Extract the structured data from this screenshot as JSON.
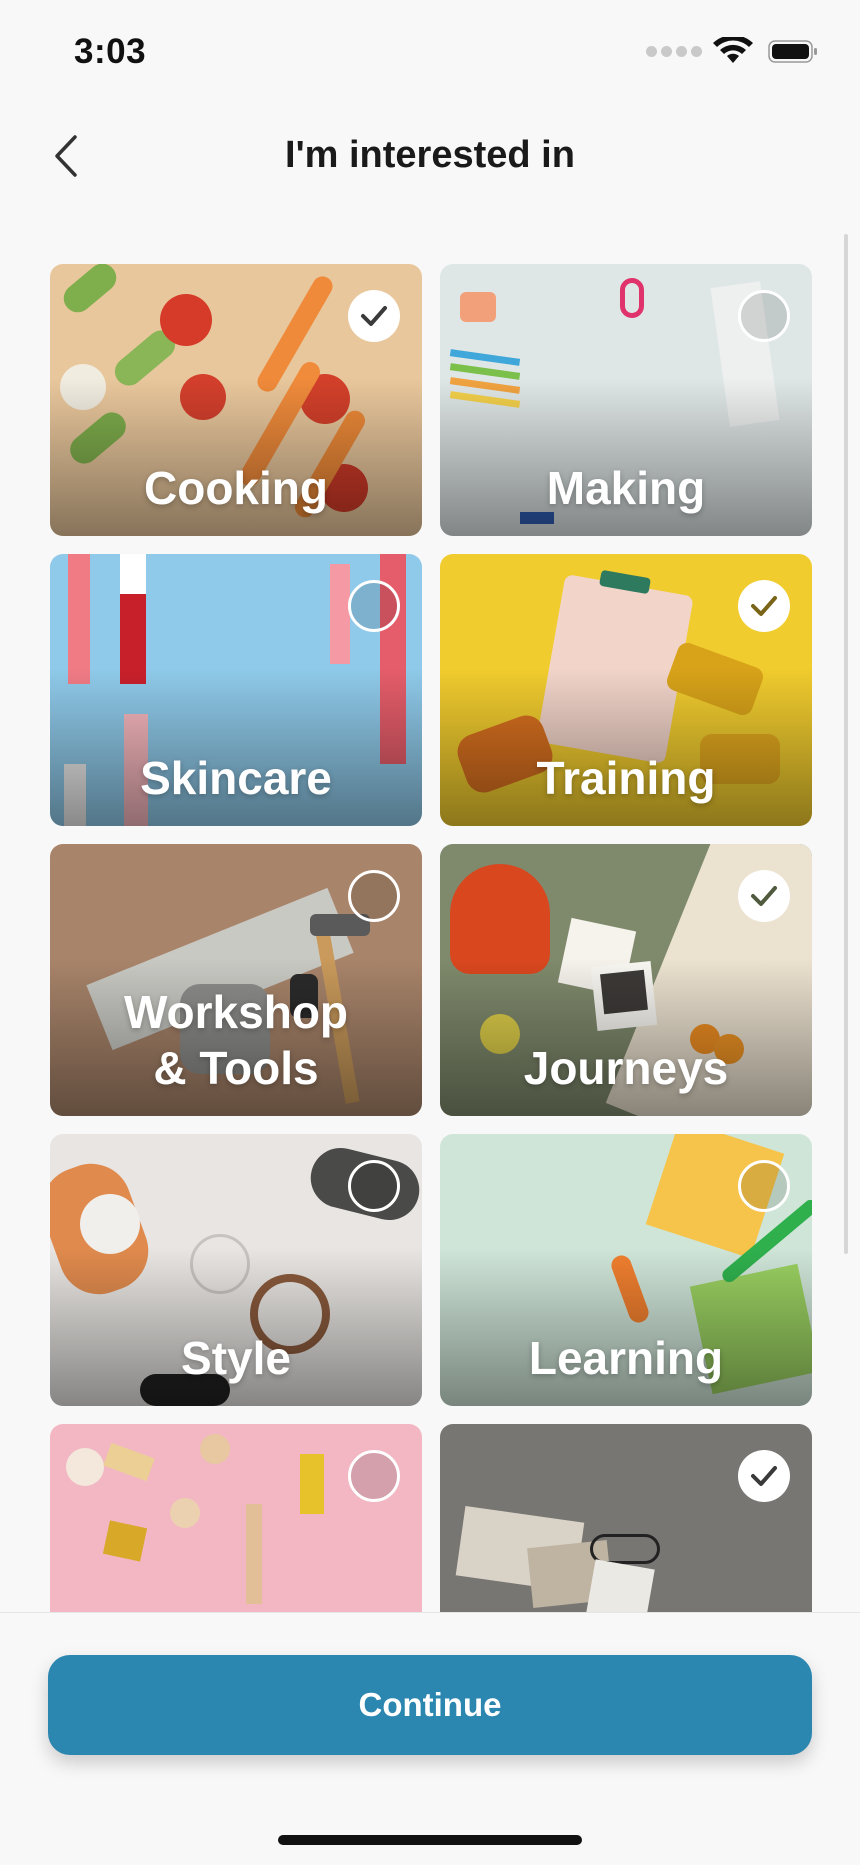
{
  "status_bar": {
    "time": "3:03",
    "icons": [
      "signal-dots-icon",
      "wifi-icon",
      "battery-icon"
    ]
  },
  "nav": {
    "title": "I'm interested in",
    "back_icon": "chevron-left-icon"
  },
  "categories": [
    {
      "label": "Cooking",
      "selected": true
    },
    {
      "label": "Making",
      "selected": false
    },
    {
      "label": "Skincare",
      "selected": false
    },
    {
      "label": "Training",
      "selected": true
    },
    {
      "label": "Workshop\n& Tools",
      "selected": false
    },
    {
      "label": "Journeys",
      "selected": true
    },
    {
      "label": "Style",
      "selected": false
    },
    {
      "label": "Learning",
      "selected": false
    },
    {
      "label": "",
      "selected": false
    },
    {
      "label": "",
      "selected": true
    }
  ],
  "footer": {
    "continue_label": "Continue"
  },
  "colors": {
    "accent": "#2b86b0",
    "background": "#f8f8f8"
  }
}
